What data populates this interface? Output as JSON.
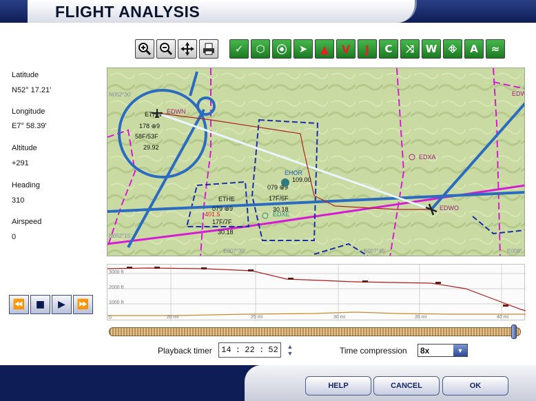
{
  "window": {
    "title": "FLIGHT ANALYSIS"
  },
  "toolbar": {
    "buttons": [
      {
        "name": "zoom-in-icon"
      },
      {
        "name": "zoom-out-icon"
      },
      {
        "name": "center-aircraft-icon"
      },
      {
        "name": "print-icon"
      },
      {
        "name": "airports-icon",
        "glyph": "✓"
      },
      {
        "name": "vor-icon",
        "glyph": "⬡"
      },
      {
        "name": "ndb-icon",
        "glyph": "⦿"
      },
      {
        "name": "aircraft-icon",
        "glyph": "➤"
      },
      {
        "name": "warning-icon",
        "glyph": "▲"
      },
      {
        "name": "v-airways-icon",
        "glyph": "V"
      },
      {
        "name": "j-airways-icon",
        "glyph": "J"
      },
      {
        "name": "class-c-icon",
        "glyph": "C"
      },
      {
        "name": "route-icon",
        "glyph": "⤨"
      },
      {
        "name": "waypoints-icon",
        "glyph": "W"
      },
      {
        "name": "airways-hl-icon",
        "glyph": "⛗"
      },
      {
        "name": "altitude-icon",
        "glyph": "A"
      },
      {
        "name": "terrain-icon",
        "glyph": "≈"
      }
    ]
  },
  "info_panel": {
    "latitude": {
      "label": "Latitude",
      "value": "N52° 17.21'"
    },
    "longitude": {
      "label": "Longitude",
      "value": "E7° 58.39'"
    },
    "altitude": {
      "label": "Altitude",
      "value": "+291"
    },
    "heading": {
      "label": "Heading",
      "value": "310"
    },
    "airspeed": {
      "label": "Airspeed",
      "value": "0"
    }
  },
  "map": {
    "airports": [
      {
        "id": "EDWN"
      },
      {
        "id": "EDXA"
      },
      {
        "id": "EDWO"
      },
      {
        "id": "EDXE"
      },
      {
        "id": "EDW"
      }
    ],
    "vor_labels": [
      {
        "id": "ETHN",
        "lines": [
          "178 ⊕9",
          "58F/53F",
          "29.92"
        ]
      },
      {
        "id": "ETHE",
        "lines": [
          "079 ⊕9",
          "17F/7F",
          "30.18"
        ],
        "extra": "401.5"
      },
      {
        "id": "EHOR",
        "lines": [
          "079 ⊕9",
          "17F/6F",
          "30.18"
        ],
        "extra": "109.00"
      }
    ],
    "grid_labels": [
      "N052°30'",
      "N052°15'",
      "E007°30'",
      "E007°45'",
      "E008°"
    ]
  },
  "profile": {
    "altitude_labels": [
      "3000 ft",
      "2000 ft",
      "1000 ft"
    ],
    "distance_labels": [
      "0",
      "20 mi",
      "25 mi",
      "30 mi",
      "35 mi",
      "40 mi"
    ]
  },
  "playback": {
    "progress": 0.99,
    "buttons": [
      {
        "name": "rewind-button",
        "glyph": "⏪"
      },
      {
        "name": "stop-button",
        "glyph": "■"
      },
      {
        "name": "play-button",
        "glyph": "▶"
      },
      {
        "name": "fast-forward-button",
        "glyph": "⏩"
      }
    ]
  },
  "timer": {
    "label": "Playback timer",
    "hours": "14",
    "minutes": "22",
    "seconds": "52"
  },
  "time_compression": {
    "label": "Time compression",
    "value": "8x"
  },
  "footer": {
    "help": "HELP",
    "cancel": "CANCEL",
    "ok": "OK"
  }
}
